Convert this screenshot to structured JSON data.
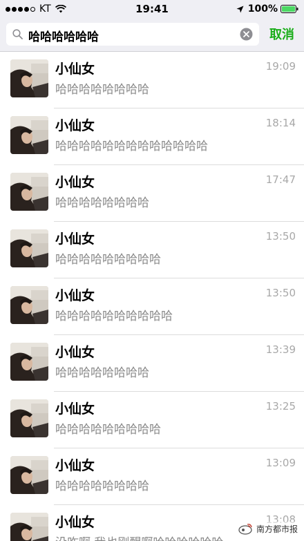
{
  "status_bar": {
    "carrier": "KT",
    "time": "19:41",
    "battery": "100%"
  },
  "search": {
    "query": "哈哈哈哈哈哈",
    "cancel_label": "取消"
  },
  "results": [
    {
      "name": "小仙女",
      "time": "19:09",
      "message": "哈哈哈哈哈哈哈哈"
    },
    {
      "name": "小仙女",
      "time": "18:14",
      "message": "哈哈哈哈哈哈哈哈哈哈哈哈哈"
    },
    {
      "name": "小仙女",
      "time": "17:47",
      "message": "哈哈哈哈哈哈哈哈"
    },
    {
      "name": "小仙女",
      "time": "13:50",
      "message": "哈哈哈哈哈哈哈哈哈"
    },
    {
      "name": "小仙女",
      "time": "13:50",
      "message": "哈哈哈哈哈哈哈哈哈哈"
    },
    {
      "name": "小仙女",
      "time": "13:39",
      "message": "哈哈哈哈哈哈哈哈"
    },
    {
      "name": "小仙女",
      "time": "13:25",
      "message": "哈哈哈哈哈哈哈哈哈"
    },
    {
      "name": "小仙女",
      "time": "13:09",
      "message": "哈哈哈哈哈哈哈哈"
    },
    {
      "name": "小仙女",
      "time": "13:08",
      "message": "没咋啊 我也刚醒啊哈哈哈哈哈哈"
    }
  ],
  "watermark": {
    "text": "南方都市报"
  },
  "colors": {
    "accent_green": "#1aad19",
    "secondary_text": "#8a8a8a"
  }
}
